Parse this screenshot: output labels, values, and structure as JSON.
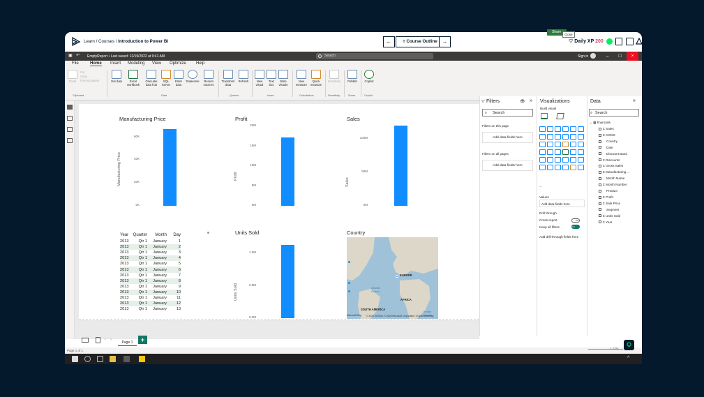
{
  "course_bar": {
    "breadcrumb_learn": "Learn",
    "breadcrumb_courses": "Courses",
    "breadcrumb_course": "Introduction to Power BI",
    "sep": "/",
    "back_arrow": "←",
    "forward_arrow": "→",
    "outline_label": "Course Outline",
    "xp_label": "Daily XP",
    "xp_value": "200"
  },
  "title_bar": {
    "file_name": "EmptyReport • Last saved: 12/19/2022 at 9:41 AM",
    "search_placeholder": "Search",
    "sign_in": "Sign in",
    "minimize": "–",
    "restore": "□",
    "close": "×",
    "close_tooltip": "Close"
  },
  "menu": {
    "items": [
      "File",
      "Home",
      "Insert",
      "Modeling",
      "View",
      "Optimize",
      "Help"
    ],
    "active": "Home",
    "share": "Share"
  },
  "ribbon": {
    "clipboard": [
      "Paste",
      "Cut",
      "Copy",
      "Format painter"
    ],
    "data_buttons": [
      "Get data",
      "Excel workbook",
      "OneLake data hub",
      "SQL Server",
      "Enter data",
      "Dataverse",
      "Recent sources"
    ],
    "query_buttons": [
      "Transform data",
      "Refresh"
    ],
    "insert_buttons": [
      "New visual",
      "Text box",
      "More visuals"
    ],
    "calc_buttons": [
      "New measure",
      "Quick measure"
    ],
    "other_buttons": [
      "Sensitivity",
      "Publish",
      "Copilot"
    ],
    "groups": [
      "Clipboard",
      "Data",
      "Queries",
      "Insert",
      "Calculations",
      "Sensitivity",
      "Share",
      "Copilot"
    ]
  },
  "charts": {
    "manufacturing": {
      "title": "Manufacturing Price",
      "ylabel": "Manufacturing Price",
      "ticks": [
        "60K",
        "40K",
        "20K",
        "0K"
      ],
      "value_fraction": 0.88
    },
    "profit": {
      "title": "Profit",
      "ylabel": "Profit",
      "ticks": [
        "20M",
        "15M",
        "10M",
        "5M",
        "0M"
      ],
      "value_fraction": 0.68
    },
    "sales": {
      "title": "Sales",
      "ylabel": "Sales",
      "ticks": [
        "100M",
        "50M",
        "0M"
      ],
      "value_fraction": 0.95
    },
    "units": {
      "title": "Units Sold",
      "ylabel": "Units Sold",
      "ticks": [
        "1.0M",
        "0.5M",
        "0.0M"
      ],
      "value_fraction": 0.84
    }
  },
  "matrix": {
    "headers": [
      "Year",
      "Quarter",
      "Month",
      "Day"
    ],
    "rows": [
      [
        "2013",
        "Qtr 1",
        "January",
        "1"
      ],
      [
        "2013",
        "Qtr 1",
        "January",
        "2"
      ],
      [
        "2013",
        "Qtr 1",
        "January",
        "3"
      ],
      [
        "2013",
        "Qtr 1",
        "January",
        "4"
      ],
      [
        "2013",
        "Qtr 1",
        "January",
        "5"
      ],
      [
        "2013",
        "Qtr 1",
        "January",
        "6"
      ],
      [
        "2013",
        "Qtr 1",
        "January",
        "7"
      ],
      [
        "2013",
        "Qtr 1",
        "January",
        "8"
      ],
      [
        "2013",
        "Qtr 1",
        "January",
        "9"
      ],
      [
        "2013",
        "Qtr 1",
        "January",
        "10"
      ],
      [
        "2013",
        "Qtr 1",
        "January",
        "11"
      ],
      [
        "2013",
        "Qtr 1",
        "January",
        "12"
      ],
      [
        "2013",
        "Qtr 1",
        "January",
        "13"
      ]
    ]
  },
  "map": {
    "title": "Country",
    "labels": [
      "EUROPE",
      "AFRICA",
      "SOUTH AMERICA"
    ],
    "ocean": "Atlantic Ocean",
    "ocean2": "Indian Ocean",
    "copyright": "© 2025 TomTom, © 2025 Microsoft Corporation, ©OpenStreetMap",
    "bing": "Microsoft Bing"
  },
  "pages": {
    "tab": "Page 1",
    "add": "+",
    "status": "Page 1 of 1"
  },
  "filters": {
    "title": "Filters",
    "search": "Search",
    "on_page": "Filters on this page",
    "on_all": "Filters on all pages",
    "add_here": "Add data fields here"
  },
  "visualizations": {
    "title": "Visualizations",
    "build": "Build visual",
    "values": "Values",
    "add_here": "Add data fields here",
    "drill": "Drill through",
    "cross": "Cross-report",
    "cross_state": "Off",
    "keep": "Keep all filters",
    "keep_state": "On",
    "add_drill": "Add drill-through fields here",
    "more": "..."
  },
  "data_pane": {
    "title": "Data",
    "search": "Search",
    "table": "financials",
    "fields": [
      "Sales",
      "COGS",
      "Country",
      "Date",
      "Discount Band",
      "Discounts",
      "Gross Sales",
      "Manufacturing ...",
      "Month Name",
      "Month Number",
      "Product",
      "Profit",
      "Sale Price",
      "Segment",
      "Units Sold",
      "Year"
    ],
    "sigma": [
      "Sales",
      "COGS",
      "Discounts",
      "Gross Sales",
      "Manufacturing ...",
      "Month Number",
      "Profit",
      "Sale Price",
      "Units Sold",
      "Year"
    ]
  },
  "zoom": {
    "label": "+ 11%"
  },
  "colors": {
    "accent": "#118dff",
    "brand": "#03ef62",
    "close": "#e81123",
    "share": "#2c7c3b"
  }
}
